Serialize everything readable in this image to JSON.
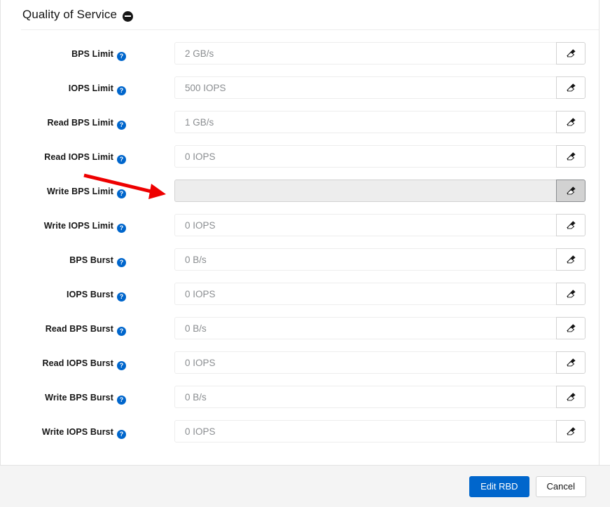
{
  "section": {
    "title": "Quality of Service",
    "collapse_icon": "minus-circle-icon"
  },
  "form": {
    "erase_icon": "eraser-icon",
    "help_icon": "question-circle-icon",
    "rows": [
      {
        "label": "BPS Limit",
        "value": "2 GB/s",
        "placeholder": "2 GB/s",
        "disabled": false,
        "button_active": false
      },
      {
        "label": "IOPS Limit",
        "value": "500 IOPS",
        "placeholder": "500 IOPS",
        "disabled": false,
        "button_active": false
      },
      {
        "label": "Read BPS Limit",
        "value": "1 GB/s",
        "placeholder": "1 GB/s",
        "disabled": false,
        "button_active": false
      },
      {
        "label": "Read IOPS Limit",
        "value": "0 IOPS",
        "placeholder": "0 IOPS",
        "disabled": false,
        "button_active": false
      },
      {
        "label": "Write BPS Limit",
        "value": "",
        "placeholder": "",
        "disabled": true,
        "button_active": true
      },
      {
        "label": "Write IOPS Limit",
        "value": "0 IOPS",
        "placeholder": "0 IOPS",
        "disabled": false,
        "button_active": false
      },
      {
        "label": "BPS Burst",
        "value": "0 B/s",
        "placeholder": "0 B/s",
        "disabled": false,
        "button_active": false
      },
      {
        "label": "IOPS Burst",
        "value": "0 IOPS",
        "placeholder": "0 IOPS",
        "disabled": false,
        "button_active": false
      },
      {
        "label": "Read BPS Burst",
        "value": "0 B/s",
        "placeholder": "0 B/s",
        "disabled": false,
        "button_active": false
      },
      {
        "label": "Read IOPS Burst",
        "value": "0 IOPS",
        "placeholder": "0 IOPS",
        "disabled": false,
        "button_active": false
      },
      {
        "label": "Write BPS Burst",
        "value": "0 B/s",
        "placeholder": "0 B/s",
        "disabled": false,
        "button_active": false
      },
      {
        "label": "Write IOPS Burst",
        "value": "0 IOPS",
        "placeholder": "0 IOPS",
        "disabled": false,
        "button_active": false
      }
    ]
  },
  "footer": {
    "submit_label": "Edit RBD",
    "cancel_label": "Cancel"
  },
  "annotation": {
    "type": "arrow",
    "color": "#ee0000",
    "points_to": "Write BPS Limit input"
  },
  "colors": {
    "accent_blue": "#0066cc",
    "help_icon_blue": "#0066cc",
    "annotation_red": "#ee0000",
    "footer_background": "#f4f4f4",
    "disabled_input": "#ededed"
  }
}
